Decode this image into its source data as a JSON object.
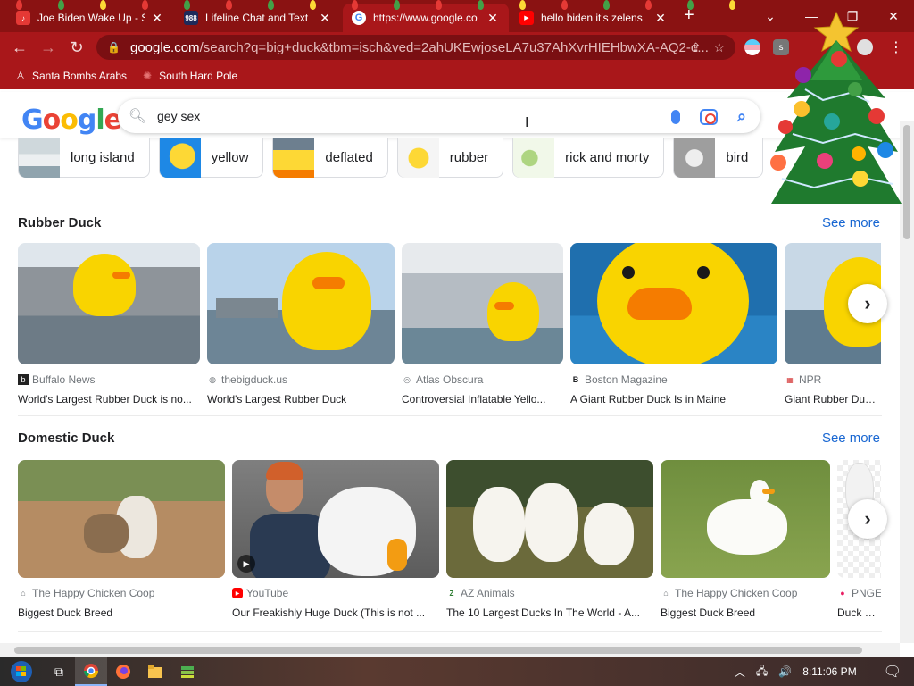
{
  "tabs": [
    {
      "title": "Joe Biden Wake Up - S",
      "favicon": "music-icon",
      "color": "#e53935"
    },
    {
      "title": "Lifeline Chat and Text",
      "favicon": "988-icon",
      "color": "#1e2a5a",
      "favicon_text": "988"
    },
    {
      "title": "https://www.google.co",
      "favicon": "google-icon",
      "color": "#ffffff"
    },
    {
      "title": "hello biden it's zelens",
      "favicon": "youtube-icon",
      "color": "#ff0000"
    }
  ],
  "address_bar": {
    "host": "google.com",
    "path": "/search?q=big+duck&tbm=isch&ved=2ahUKEwjoseLA7u37AhXvrHIEHbwXA-AQ2-c..."
  },
  "bookmarks": [
    {
      "label": "Santa Bombs Arabs",
      "icon": "figure-icon"
    },
    {
      "label": "South Hard Pole",
      "icon": "star-badge-icon"
    }
  ],
  "search": {
    "query": "gey sex"
  },
  "chips": [
    {
      "label": "long island",
      "thumb": "#cfd8dc"
    },
    {
      "label": "yellow",
      "thumb": "#1e88e5"
    },
    {
      "label": "deflated",
      "thumb": "#fdd835"
    },
    {
      "label": "rubber",
      "thumb": "#f5f5f5"
    },
    {
      "label": "rick and morty",
      "thumb": "#e8f5e9"
    },
    {
      "label": "bird",
      "thumb": "#bdbdbd"
    }
  ],
  "sections": [
    {
      "title": "Rubber Duck",
      "see_more": "See more",
      "cards": [
        {
          "source": "Buffalo News",
          "source_icon": "bn-icon",
          "caption": "World's Largest Rubber Duck is no..."
        },
        {
          "source": "thebigduck.us",
          "source_icon": "globe-icon",
          "caption": "World's Largest Rubber Duck"
        },
        {
          "source": "Atlas Obscura",
          "source_icon": "atlas-icon",
          "caption": "Controversial Inflatable Yello..."
        },
        {
          "source": "Boston Magazine",
          "source_icon": "b-icon",
          "caption": "A Giant Rubber Duck Is in Maine"
        },
        {
          "source": "NPR",
          "source_icon": "npr-icon",
          "caption": "Giant Rubber Duck I"
        }
      ]
    },
    {
      "title": "Domestic Duck",
      "see_more": "See more",
      "cards": [
        {
          "source": "The Happy Chicken Coop",
          "source_icon": "coop-icon",
          "caption": "Biggest Duck Breed"
        },
        {
          "source": "YouTube",
          "source_icon": "youtube-icon",
          "caption": "Our Freakishly Huge Duck (This is not ..."
        },
        {
          "source": "AZ Animals",
          "source_icon": "az-icon",
          "caption": "The 10 Largest Ducks In The World - A..."
        },
        {
          "source": "The Happy Chicken Coop",
          "source_icon": "coop-icon",
          "caption": "Biggest Duck Breed"
        },
        {
          "source": "PNGE",
          "source_icon": "pin-icon",
          "caption": "Duck Dor"
        }
      ]
    }
  ],
  "taskbar": {
    "time": "8:11:06 PM"
  },
  "colors": {
    "chrome_dark": "#8a1212",
    "chrome": "#a9171a",
    "link_blue": "#1967d2",
    "duck_yellow": "#f9d400"
  }
}
